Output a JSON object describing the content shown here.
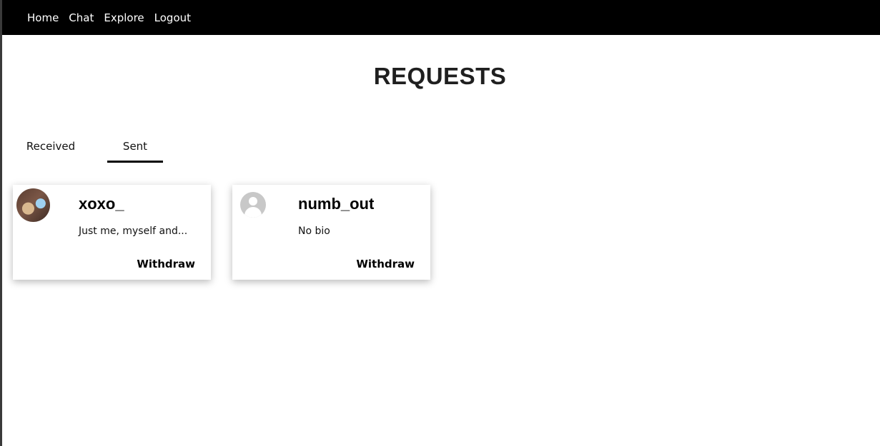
{
  "nav": {
    "items": [
      {
        "label": "Home"
      },
      {
        "label": "Chat"
      },
      {
        "label": "Explore"
      },
      {
        "label": "Logout"
      }
    ]
  },
  "page": {
    "title": "REQUESTS"
  },
  "tabs": {
    "received": {
      "label": "Received"
    },
    "sent": {
      "label": "Sent"
    },
    "active": "Sent"
  },
  "requests": [
    {
      "username": "xoxo_",
      "bio": "Just me, myself and...",
      "avatar": "profile-photo",
      "action": "Withdraw"
    },
    {
      "username": "numb_out",
      "bio": "No bio",
      "avatar": "default-avatar-icon",
      "action": "Withdraw"
    }
  ],
  "colors": {
    "navbar_bg": "#000000",
    "nav_text": "#ffffff",
    "title": "#1f1f1f",
    "tab_underline": "#000000"
  }
}
